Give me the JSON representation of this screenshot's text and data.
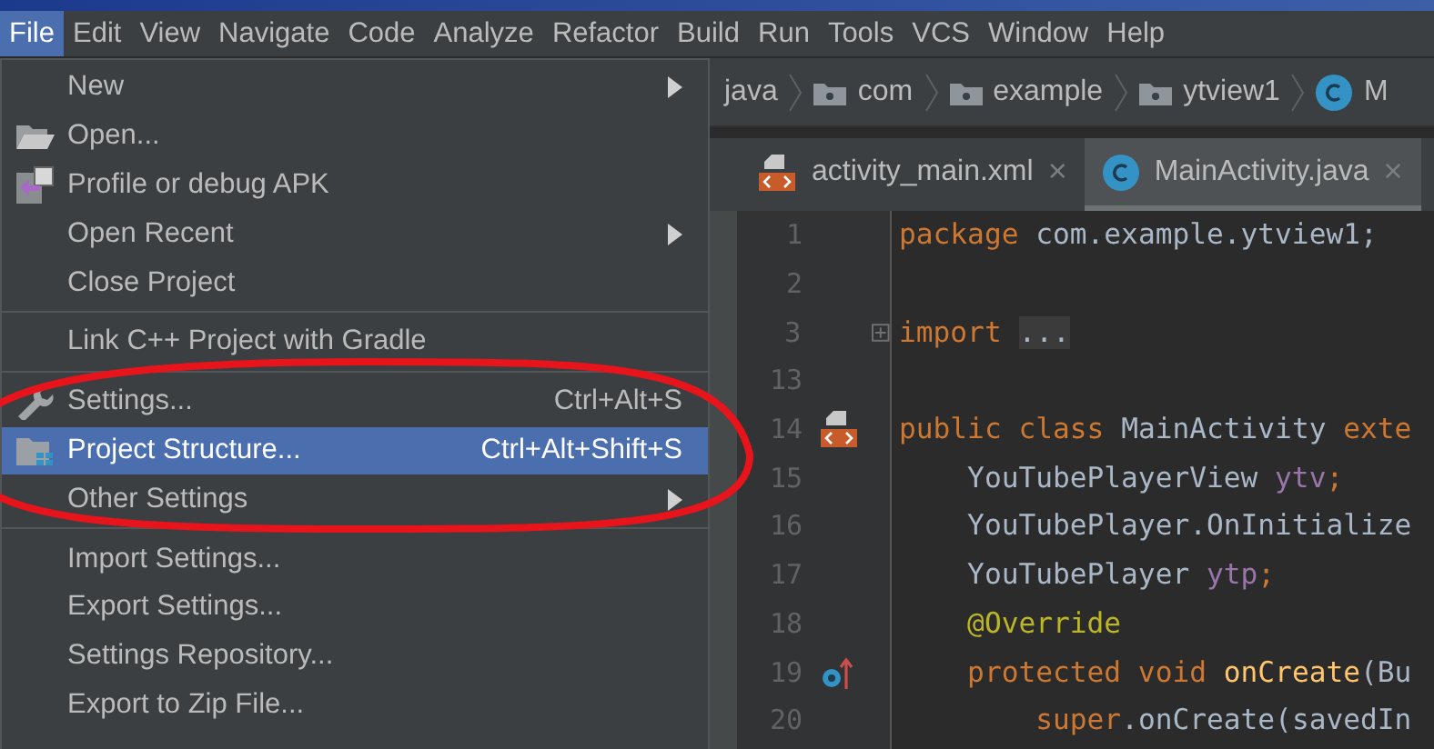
{
  "menu_bar": [
    {
      "label": "File",
      "selected": true
    },
    {
      "label": "Edit",
      "selected": false
    },
    {
      "label": "View",
      "selected": false
    },
    {
      "label": "Navigate",
      "selected": false
    },
    {
      "label": "Code",
      "selected": false
    },
    {
      "label": "Analyze",
      "selected": false
    },
    {
      "label": "Refactor",
      "selected": false
    },
    {
      "label": "Build",
      "selected": false
    },
    {
      "label": "Run",
      "selected": false
    },
    {
      "label": "Tools",
      "selected": false
    },
    {
      "label": "VCS",
      "selected": false
    },
    {
      "label": "Window",
      "selected": false
    },
    {
      "label": "Help",
      "selected": false
    }
  ],
  "breadcrumb": [
    "java",
    "com",
    "example",
    "ytview1",
    "M"
  ],
  "tabs": [
    {
      "label": "activity_main.xml",
      "kind": "xml",
      "close": "×",
      "selected": false
    },
    {
      "label": "MainActivity.java",
      "kind": "class",
      "close": "×",
      "selected": true
    }
  ],
  "code_lines": [
    {
      "number": "1",
      "tokens": [
        {
          "kind": "keyword",
          "text": "package "
        },
        {
          "kind": "plain",
          "text": "com.example.ytview1;"
        }
      ]
    },
    {
      "number": "2"
    },
    {
      "number": "3",
      "folded": true,
      "tokens": [
        {
          "kind": "keyword",
          "text": "import "
        },
        {
          "kind": "folded",
          "text": "..."
        }
      ]
    },
    {
      "number": "13"
    },
    {
      "number": "14",
      "tokens": [
        {
          "kind": "keyword",
          "text": "public class "
        },
        {
          "kind": "plain",
          "text": "MainActivity "
        },
        {
          "kind": "keyword",
          "text": "exte"
        }
      ]
    },
    {
      "number": "15",
      "tokens": [
        {
          "kind": "plain",
          "text": "    YouTubePlayerView "
        },
        {
          "kind": "field",
          "text": "ytv"
        },
        {
          "kind": "keyword",
          "text": ";"
        }
      ]
    },
    {
      "number": "16",
      "tokens": [
        {
          "kind": "plain",
          "text": "    YouTubePlayer.OnInitialize"
        }
      ]
    },
    {
      "number": "17",
      "tokens": [
        {
          "kind": "plain",
          "text": "    YouTubePlayer "
        },
        {
          "kind": "field",
          "text": "ytp"
        },
        {
          "kind": "keyword",
          "text": ";"
        }
      ]
    },
    {
      "number": "18",
      "tokens": [
        {
          "kind": "annotation",
          "text": "    @Override"
        }
      ]
    },
    {
      "number": "19",
      "tokens": [
        {
          "kind": "keyword",
          "text": "    protected void "
        },
        {
          "kind": "method",
          "text": "onCreate"
        },
        {
          "kind": "plain",
          "text": "(Bu"
        }
      ]
    },
    {
      "number": "20",
      "tokens": [
        {
          "kind": "keyword",
          "text": "        super"
        },
        {
          "kind": "plain",
          "text": ".onCreate(savedIn"
        }
      ]
    }
  ],
  "file_menu": [
    {
      "label": "New",
      "kind": "submenu",
      "selected": false
    },
    {
      "label": "Open...",
      "kind": "action",
      "selected": false
    },
    {
      "label": "Profile or debug APK",
      "kind": "action",
      "selected": false
    },
    {
      "label": "Open Recent",
      "kind": "submenu",
      "selected": false
    },
    {
      "label": "Close Project",
      "kind": "action",
      "selected": false
    },
    {
      "kind": "separator"
    },
    {
      "label": "Link C++ Project with Gradle",
      "kind": "action",
      "selected": false
    },
    {
      "kind": "separator"
    },
    {
      "label": "Settings...",
      "kind": "action",
      "shortcut": "Ctrl+Alt+S",
      "selected": false
    },
    {
      "label": "Project Structure...",
      "kind": "action",
      "shortcut": "Ctrl+Alt+Shift+S",
      "selected": true
    },
    {
      "label": "Other Settings",
      "kind": "submenu",
      "selected": false
    },
    {
      "kind": "separator"
    },
    {
      "label": "Import Settings...",
      "kind": "action",
      "selected": false
    },
    {
      "label": "Export Settings...",
      "kind": "action",
      "selected": false
    },
    {
      "label": "Settings Repository...",
      "kind": "action",
      "selected": false
    },
    {
      "label": "Export to Zip File...",
      "kind": "action",
      "selected": false
    }
  ]
}
